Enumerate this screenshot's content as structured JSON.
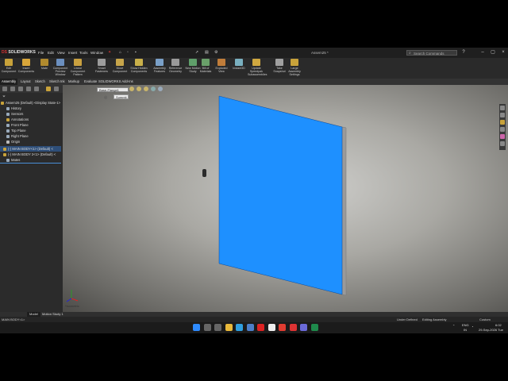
{
  "app": {
    "logo_prefix": "DS",
    "logo_text": "SOLIDWORKS",
    "document_title": "Assem25 *",
    "search_placeholder": "Search Commands"
  },
  "menus": [
    "File",
    "Edit",
    "View",
    "Insert",
    "Tools",
    "Window"
  ],
  "ribbon": [
    {
      "label": "Edit Component",
      "icon": "edit-component-icon",
      "color": "#c8a23a"
    },
    {
      "label": "Insert Components",
      "icon": "insert-components-icon",
      "color": "#d9a63a"
    },
    {
      "label": "Mate",
      "icon": "mate-icon",
      "color": "#b08a2e"
    },
    {
      "label": "Component Preview Window",
      "icon": "preview-window-icon",
      "color": "#6b8fbf"
    },
    {
      "label": "Linear Component Pattern",
      "icon": "linear-pattern-icon",
      "color": "#c9a03f"
    },
    {
      "label": "Smart Fasteners",
      "icon": "smart-fasteners-icon",
      "color": "#9c9c9c"
    },
    {
      "label": "Move Component",
      "icon": "move-component-icon",
      "color": "#c7a54a"
    },
    {
      "label": "Show Hidden Components",
      "icon": "show-hidden-icon",
      "color": "#c9b04a"
    },
    {
      "label": "Assembly Features",
      "icon": "assembly-features-icon",
      "color": "#7aa0c8"
    },
    {
      "label": "Reference Geometry",
      "icon": "reference-geometry-icon",
      "color": "#9a9a9a"
    },
    {
      "label": "New Motion Study",
      "icon": "motion-study-icon",
      "color": "#5f9f6a"
    },
    {
      "label": "Bill of Materials",
      "icon": "bom-icon",
      "color": "#6aa06a"
    },
    {
      "label": "Exploded View",
      "icon": "exploded-view-icon",
      "color": "#c07d3a"
    },
    {
      "label": "Instant3D",
      "icon": "instant3d-icon",
      "color": "#7ab0c0"
    },
    {
      "label": "Update Speedpak Subassemblies",
      "icon": "speedpak-icon",
      "color": "#d0a840"
    },
    {
      "label": "Take Snapshot",
      "icon": "snapshot-icon",
      "color": "#a0a0a0"
    },
    {
      "label": "Large Assembly Settings",
      "icon": "large-assembly-icon",
      "color": "#c8a23a"
    }
  ],
  "tabs": [
    {
      "label": "Assembly",
      "active": true
    },
    {
      "label": "Layout",
      "active": false
    },
    {
      "label": "Sketch",
      "active": false
    },
    {
      "label": "Sketch Ink",
      "active": false
    },
    {
      "label": "Markup",
      "active": false
    },
    {
      "label": "Evaluate",
      "active": false
    },
    {
      "label": "SOLIDWORKS Add-Ins",
      "active": false
    }
  ],
  "tree": [
    {
      "label": "Assem25 (Default) <Display State-1>",
      "icon_color": "#c8a23a",
      "state": ""
    },
    {
      "label": "History",
      "icon_color": "#9ab",
      "state": ""
    },
    {
      "label": "Sensors",
      "icon_color": "#9ab",
      "state": ""
    },
    {
      "label": "Annotations",
      "icon_color": "#c8a23a",
      "state": ""
    },
    {
      "label": "Front Plane",
      "icon_color": "#9ab",
      "state": ""
    },
    {
      "label": "Top Plane",
      "icon_color": "#9ab",
      "state": ""
    },
    {
      "label": "Right Plane",
      "icon_color": "#9ab",
      "state": ""
    },
    {
      "label": "Origin",
      "icon_color": "#bbb",
      "state": ""
    },
    {
      "label": "(-) MAIN BODY<1> (Default) <",
      "icon_color": "#c8a23a",
      "state": "selected"
    },
    {
      "label": "(-) MAIN BODY 2<1> (Default) <",
      "icon_color": "#c8a23a",
      "state": ""
    },
    {
      "label": "Mates",
      "icon_color": "#9ab",
      "state": "hl"
    }
  ],
  "viewport": {
    "popup_label": "Base-Flange1",
    "popup_sub": "Summit",
    "view_label": "*Isometric",
    "panel_color": "#1e90ff"
  },
  "bottom_tabs": [
    {
      "label": "Model",
      "active": true
    },
    {
      "label": "Motion Study 1",
      "active": false
    }
  ],
  "status": {
    "left": "MAIN BODY<1>",
    "under_defined": "Under Defined",
    "editing": "Editing Assembly",
    "units": "Custom"
  },
  "taskbar": {
    "icons": [
      {
        "name": "windows-start-icon",
        "color": "#2e8bff"
      },
      {
        "name": "search-icon",
        "color": "#666"
      },
      {
        "name": "task-view-icon",
        "color": "#666"
      },
      {
        "name": "file-explorer-icon",
        "color": "#e8b83a"
      },
      {
        "name": "edge-icon",
        "color": "#2f9fe0"
      },
      {
        "name": "photos-icon",
        "color": "#4c7ec8"
      },
      {
        "name": "acrobat-icon",
        "color": "#d22"
      },
      {
        "name": "notes-icon",
        "color": "#eee"
      },
      {
        "name": "gmail-icon",
        "color": "#e03c31"
      },
      {
        "name": "solidworks-icon",
        "color": "#d33"
      },
      {
        "name": "chat-icon",
        "color": "#6a6ad8"
      },
      {
        "name": "excel-icon",
        "color": "#1f8a4c"
      }
    ],
    "lang": "ENG",
    "region": "IN",
    "time": "6:02",
    "date": "29-Sep-2026 Tue"
  }
}
